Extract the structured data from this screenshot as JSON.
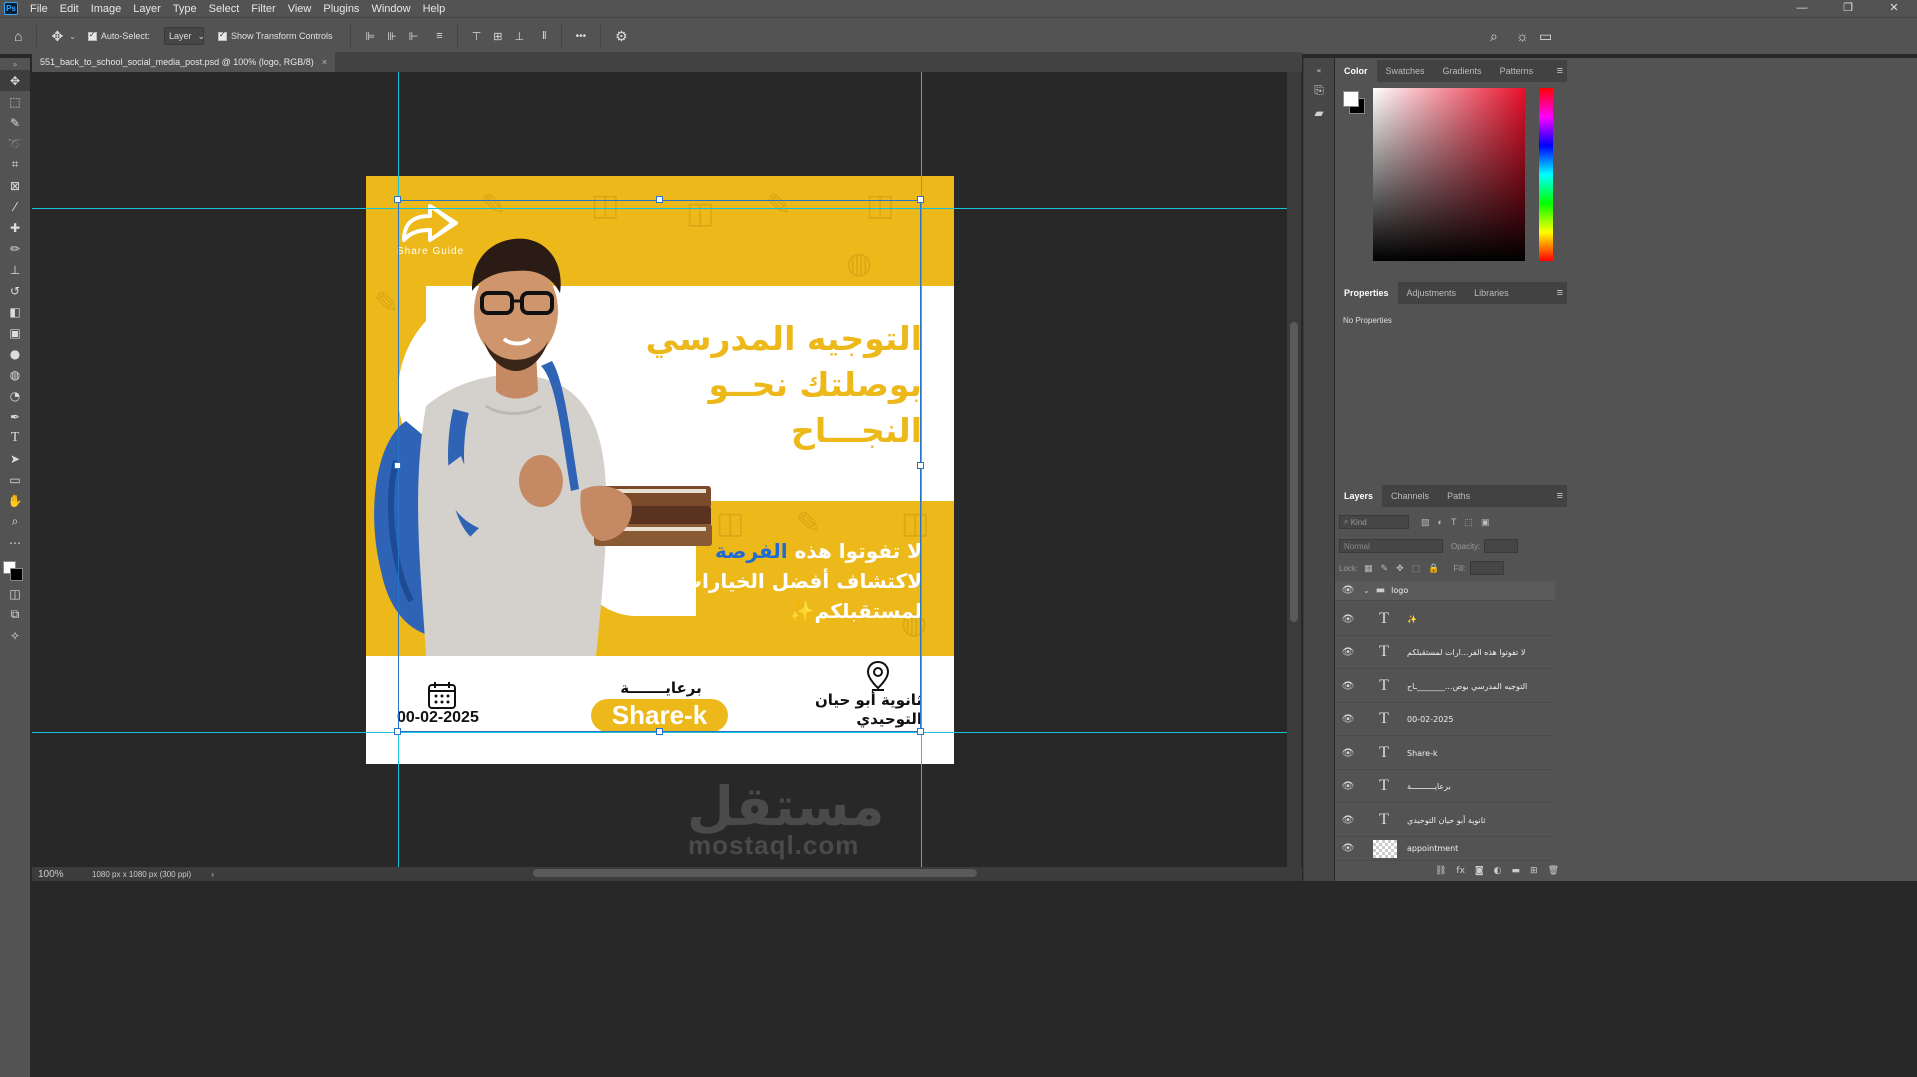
{
  "menubar": {
    "logo": "Ps",
    "items": [
      "File",
      "Edit",
      "Image",
      "Layer",
      "Type",
      "Select",
      "Filter",
      "View",
      "Plugins",
      "Window",
      "Help"
    ],
    "win_minimize": "—",
    "win_restore": "❐",
    "win_close": "✕"
  },
  "options": {
    "auto_select_label": "Auto-Select:",
    "auto_select_target": "Layer",
    "show_transform_label": "Show Transform Controls",
    "more": "•••"
  },
  "document": {
    "tab_title": "551_back_to_school_social_media_post.psd @ 100% (logo, RGB/8)",
    "zoom": "100%",
    "doc_info": "1080 px x 1080 px (300 ppi)"
  },
  "artwork": {
    "logo_text": "Share Guide",
    "headline_lines": [
      "التوجيه المدرسي",
      "بوصلتك نحــو",
      "النجـــاح"
    ],
    "subline_prefix": "لا تفوتوا هذه ",
    "subline_highlight": "الفرصة",
    "subline_rest": "لاكتشاف أفضل الخيارات",
    "subline_last": "لمستقبلكم",
    "sparkle": "✨",
    "date": "00-02-2025",
    "sponsor_label": "برعايـــــــة",
    "brand": "Share-k",
    "school_line1": "ثانوية أبو حيان",
    "school_line2": "التوحيدي"
  },
  "watermark": {
    "arabic": "مستقل",
    "latin": "mostaql.com"
  },
  "color_panel": {
    "tabs": [
      "Color",
      "Swatches",
      "Gradients",
      "Patterns"
    ],
    "active": "Color",
    "foreground": "#ffffff",
    "background": "#000000",
    "hue": "#e8102a"
  },
  "properties_panel": {
    "tabs": [
      "Properties",
      "Adjustments",
      "Libraries"
    ],
    "active": "Properties",
    "empty_text": "No Properties"
  },
  "layers_panel": {
    "tabs": [
      "Layers",
      "Channels",
      "Paths"
    ],
    "active": "Layers",
    "filter_placeholder": "Kind",
    "blend_mode": "Normal",
    "opacity_label": "Opacity:",
    "lock_label": "Lock:",
    "fill_label": "Fill:",
    "layers": [
      {
        "name": "logo",
        "type": "group"
      },
      {
        "name": "✨",
        "type": "text"
      },
      {
        "name": "لا تفوتوا هذه الفر...ارات  لمستقبلكم",
        "type": "text"
      },
      {
        "name": "التوجيه المدرسي بوص..._______ـاح",
        "type": "text"
      },
      {
        "name": "00-02-2025",
        "type": "text"
      },
      {
        "name": "Share-k",
        "type": "text"
      },
      {
        "name": "برعايــــــــــة",
        "type": "text"
      },
      {
        "name": "ثانوية أبو حيان  التوحيدي",
        "type": "text"
      },
      {
        "name": "appointment",
        "type": "image"
      }
    ]
  }
}
